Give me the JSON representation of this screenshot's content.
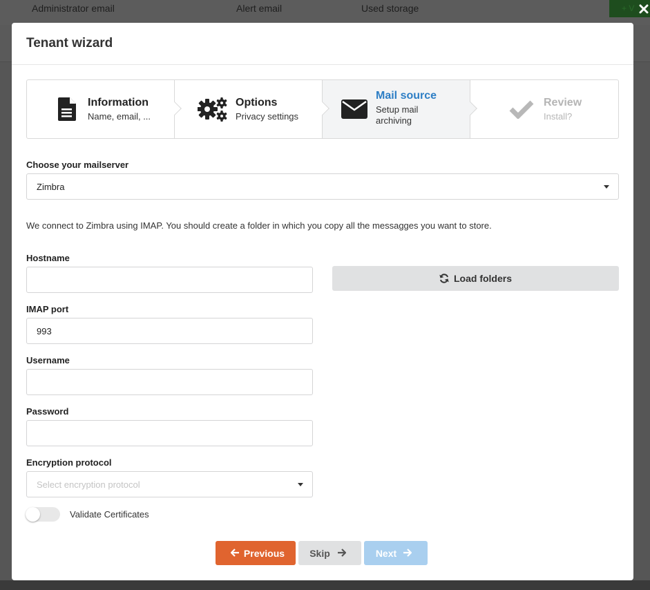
{
  "background": {
    "columns": [
      "Administrator email",
      "Alert email",
      "Used storage"
    ],
    "add_button_label": "+ V"
  },
  "modal": {
    "title": "Tenant wizard",
    "close_icon": "close-icon"
  },
  "steps": [
    {
      "title": "Information",
      "subtitle": "Name, email, ...",
      "icon": "document-icon",
      "state": "done"
    },
    {
      "title": "Options",
      "subtitle": "Privacy settings",
      "icon": "gears-icon",
      "state": "done"
    },
    {
      "title": "Mail source",
      "subtitle": "Setup mail archiving",
      "icon": "envelope-icon",
      "state": "active"
    },
    {
      "title": "Review",
      "subtitle": "Install?",
      "icon": "checkmark-icon",
      "state": "disabled"
    }
  ],
  "form": {
    "mailserver_label": "Choose your mailserver",
    "mailserver_value": "Zimbra",
    "description": "We connect to Zimbra using IMAP. You should create a folder in which you copy all the messagges you want to store.",
    "hostname_label": "Hostname",
    "hostname_value": "",
    "load_folders_label": "Load folders",
    "imap_port_label": "IMAP port",
    "imap_port_value": "993",
    "username_label": "Username",
    "username_value": "",
    "password_label": "Password",
    "password_value": "",
    "encryption_label": "Encryption protocol",
    "encryption_placeholder": "Select encryption protocol",
    "validate_certificates_label": "Validate Certificates",
    "validate_certificates_on": false
  },
  "buttons": {
    "previous": "Previous",
    "skip": "Skip",
    "next": "Next"
  },
  "colors": {
    "primary_orange": "#e0642f",
    "active_blue": "#2d7ec5",
    "next_disabled": "#a9cfef",
    "secondary_grey": "#e0e1e2"
  }
}
